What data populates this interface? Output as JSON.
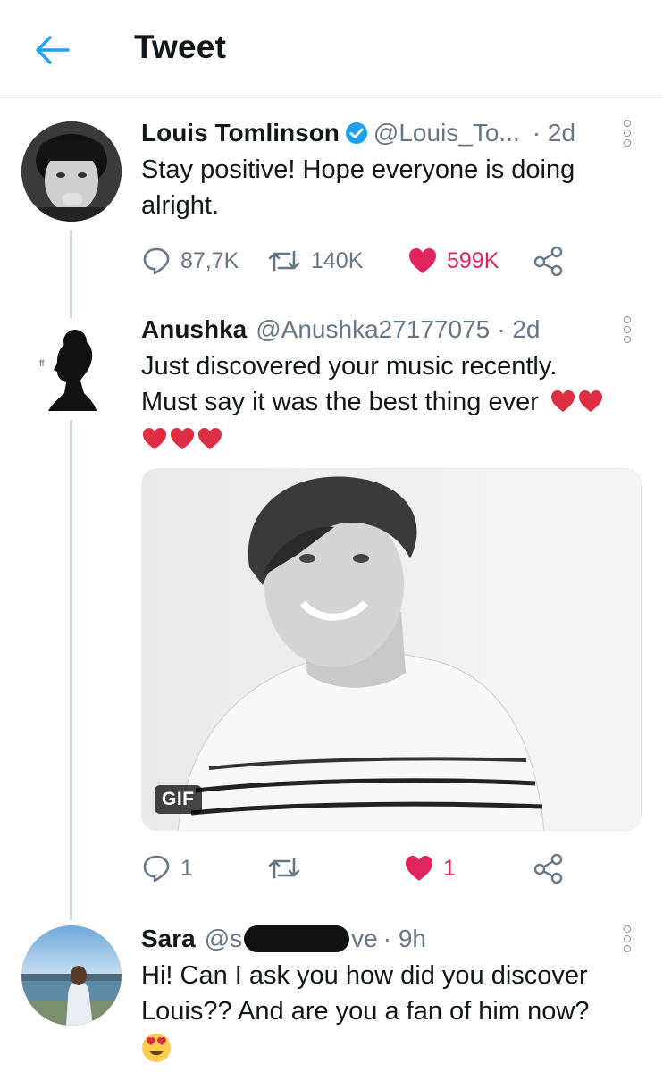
{
  "header": {
    "title": "Tweet",
    "back_icon": "arrow-left-icon",
    "accent_color": "#1da1f2"
  },
  "tweets": [
    {
      "name": "Louis Tomlinson",
      "verified": true,
      "handle": "@Louis_To...",
      "time": "· 2d",
      "text": "Stay positive! Hope everyone is doing alright.",
      "actions": {
        "replies": "87,7K",
        "retweets": "140K",
        "likes": "599K",
        "liked": true
      }
    },
    {
      "name": "Anushka",
      "handle": "@Anushka27177075",
      "time": "· 2d",
      "text_line1": "Just discovered your music recently.",
      "text_line2": "Must say it was the best thing ever",
      "emoji": "heart-emoji",
      "media_badge": "GIF",
      "actions": {
        "replies": "1",
        "retweets": "",
        "likes": "1",
        "liked": true
      }
    },
    {
      "name": "Sara",
      "handle_start": "@s",
      "handle_end": "ve",
      "time": "· 9h",
      "text": "Hi! Can I ask you how did you discover Louis?? And are you a fan of him now?",
      "emoji": "heart-eyes-emoji"
    }
  ],
  "colors": {
    "like": "#e0245e",
    "muted": "#657786",
    "verified": "#1da1f2"
  }
}
